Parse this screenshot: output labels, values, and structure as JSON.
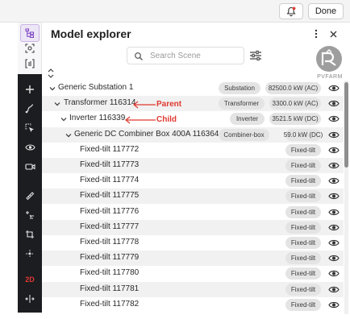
{
  "topbar": {
    "done_label": "Done",
    "bell_icon": "bell-add-icon",
    "accent": "#e0382f"
  },
  "toolbar": {
    "light_tools": [
      "hierarchy-icon",
      "focus-icon",
      "bracket-icon"
    ],
    "dark_tools": [
      "plus-icon",
      "route-icon",
      "select-icon",
      "eye-icon",
      "camera-icon",
      "ruler-icon",
      "snap-icon",
      "crop-icon",
      "move-icon"
    ],
    "mode_label": "2D",
    "last_tool": "split-icon"
  },
  "panel": {
    "title": "Model explorer"
  },
  "search": {
    "placeholder": "Search Scene"
  },
  "logo": {
    "text": "PVFARM"
  },
  "annotations": {
    "parent": "Parent",
    "child": "Child",
    "color": "#e0382f"
  },
  "tree": {
    "rows": [
      {
        "label": "Generic Substation 1",
        "type": "Substation",
        "value": "82500.0 kW (AC)"
      },
      {
        "label": "Transformer 116314",
        "type": "Transformer",
        "value": "3300.0 kW (AC)"
      },
      {
        "label": "Inverter 116339",
        "type": "Inverter",
        "value": "3521.5 kW (DC)"
      },
      {
        "label": "Generic DC Combiner Box 400A 116364",
        "type": "Combiner-box",
        "value": "59.0 kW (DC)"
      },
      {
        "label": "Fixed-tilt 117772",
        "type": "Fixed-tilt"
      },
      {
        "label": "Fixed-tilt 117773",
        "type": "Fixed-tilt"
      },
      {
        "label": "Fixed-tilt 117774",
        "type": "Fixed-tilt"
      },
      {
        "label": "Fixed-tilt 117775",
        "type": "Fixed-tilt"
      },
      {
        "label": "Fixed-tilt 117776",
        "type": "Fixed-tilt"
      },
      {
        "label": "Fixed-tilt 117777",
        "type": "Fixed-tilt"
      },
      {
        "label": "Fixed-tilt 117778",
        "type": "Fixed-tilt"
      },
      {
        "label": "Fixed-tilt 117779",
        "type": "Fixed-tilt"
      },
      {
        "label": "Fixed-tilt 117780",
        "type": "Fixed-tilt"
      },
      {
        "label": "Fixed-tilt 117781",
        "type": "Fixed-tilt"
      },
      {
        "label": "Fixed-tilt 117782",
        "type": "Fixed-tilt"
      }
    ]
  }
}
